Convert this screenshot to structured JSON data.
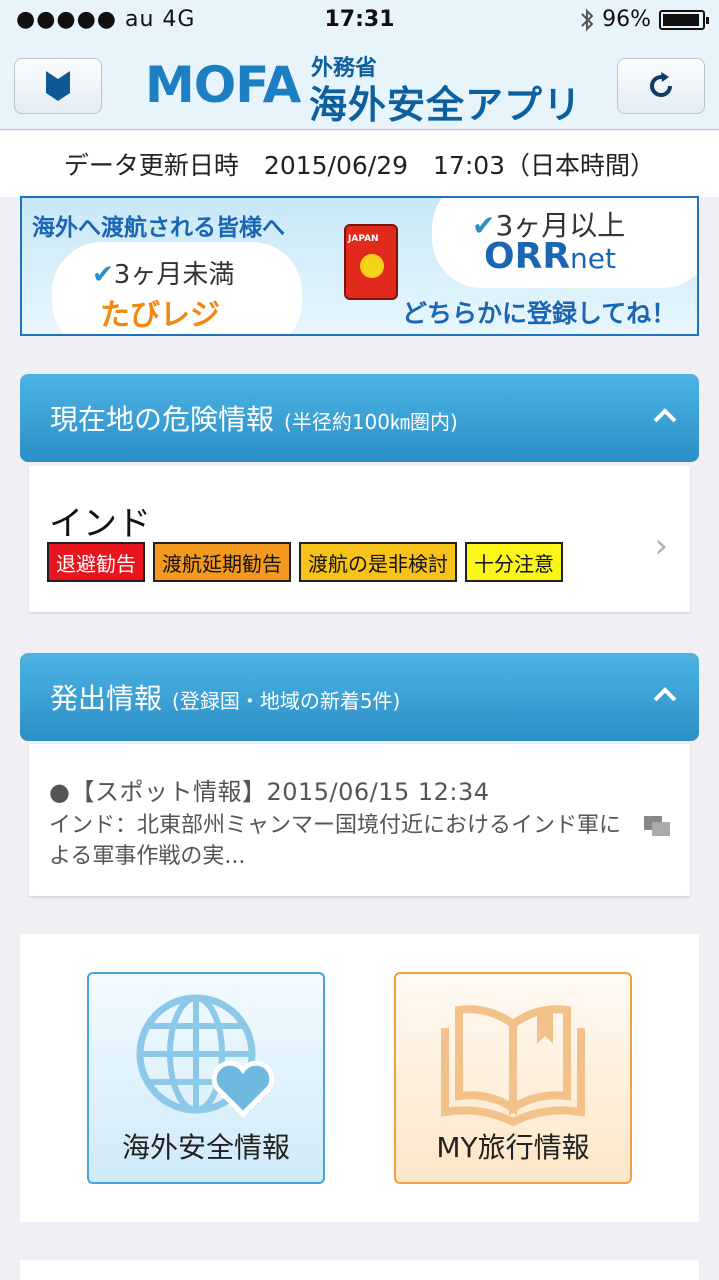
{
  "status_bar": {
    "signal": "●●●●● au 4G",
    "time": "17:31",
    "battery_text": "96%",
    "battery_level_percent": 96,
    "bluetooth_icon": "bluetooth-icon"
  },
  "nav": {
    "logo_mofa": "MOFA",
    "logo_ministry": "外務省",
    "logo_app_name": "海外安全アプリ",
    "left_button_icon": "beginner-mark-icon",
    "right_button_icon": "refresh-icon"
  },
  "update": {
    "text": "データ更新日時　2015/06/29　17:03（日本時間）"
  },
  "banner": {
    "headline": "海外へ渡航される皆様へ",
    "under_3_months": "3ヶ月未満",
    "tabireji": "たびレジ",
    "over_3_months": "3ヶ月以上",
    "orrnet_bold": "ORR",
    "orrnet_light": "net",
    "call_to_action": "どちらかに登録してね！",
    "passport_label": "JAPAN"
  },
  "danger_section": {
    "title": "現在地の危険情報",
    "subtitle": "(半径約100㎞圏内)",
    "country": "インド",
    "tags": [
      {
        "label": "退避勧告",
        "bg": "#e8141e",
        "color": "#ffffff"
      },
      {
        "label": "渡航延期勧告",
        "bg": "#f39a1e",
        "color": "#111111"
      },
      {
        "label": "渡航の是非検討",
        "bg": "#f7c21a",
        "color": "#111111"
      },
      {
        "label": "十分注意",
        "bg": "#fcf51a",
        "color": "#111111"
      }
    ]
  },
  "news_section": {
    "title": "発出情報",
    "subtitle": "(登録国・地域の新着5件)",
    "items": [
      {
        "header": "●【スポット情報】2015/06/15 12:34",
        "body": "インド：北東部州ミャンマー国境付近におけるインド軍による軍事作戦の実..."
      }
    ]
  },
  "menu": {
    "overseas_safety_label": "海外安全情報",
    "my_travel_label": "MY旅行情報"
  },
  "colors": {
    "accent": "#2b8fc7",
    "brand": "#1c7fc2"
  }
}
